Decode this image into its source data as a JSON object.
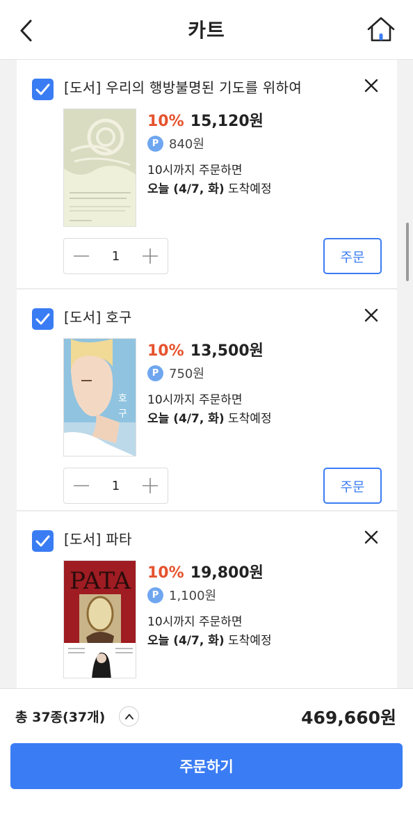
{
  "header": {
    "title": "카트",
    "back_icon": "chevron-left-icon",
    "home_icon": "home-icon"
  },
  "items": [
    {
      "title": "[도서] 우리의 행방불명된 기도를 위하여",
      "discount": "10%",
      "price": "15,120원",
      "points": "840원",
      "delivery_line1": "10시까지 주문하면",
      "delivery_date": "오늘 (4/7, 화)",
      "delivery_suffix": " 도착예정",
      "quantity": "1",
      "order_label": "주문",
      "cover_text": "우리의 행방불명된\n기도를 위하여"
    },
    {
      "title": "[도서] 호구",
      "discount": "10%",
      "price": "13,500원",
      "points": "750원",
      "delivery_line1": "10시까지 주문하면",
      "delivery_date": "오늘 (4/7, 화)",
      "delivery_suffix": " 도착예정",
      "quantity": "1",
      "order_label": "주문",
      "cover_text": "호구"
    },
    {
      "title": "[도서] 파타",
      "discount": "10%",
      "price": "19,800원",
      "points": "1,100원",
      "delivery_line1": "10시까지 주문하면",
      "delivery_date": "오늘 (4/7, 화)",
      "delivery_suffix": " 도착예정",
      "quantity": "1",
      "order_label": "주문",
      "cover_text": "PATA"
    }
  ],
  "footer": {
    "total_count": "총 37종(37개)",
    "total_price": "469,660원",
    "checkout_label": "주문하기"
  },
  "colors": {
    "accent": "#3a7cf3",
    "discount": "#e5532d",
    "point_badge": "#6fa6ef"
  },
  "point_badge_label": "P"
}
